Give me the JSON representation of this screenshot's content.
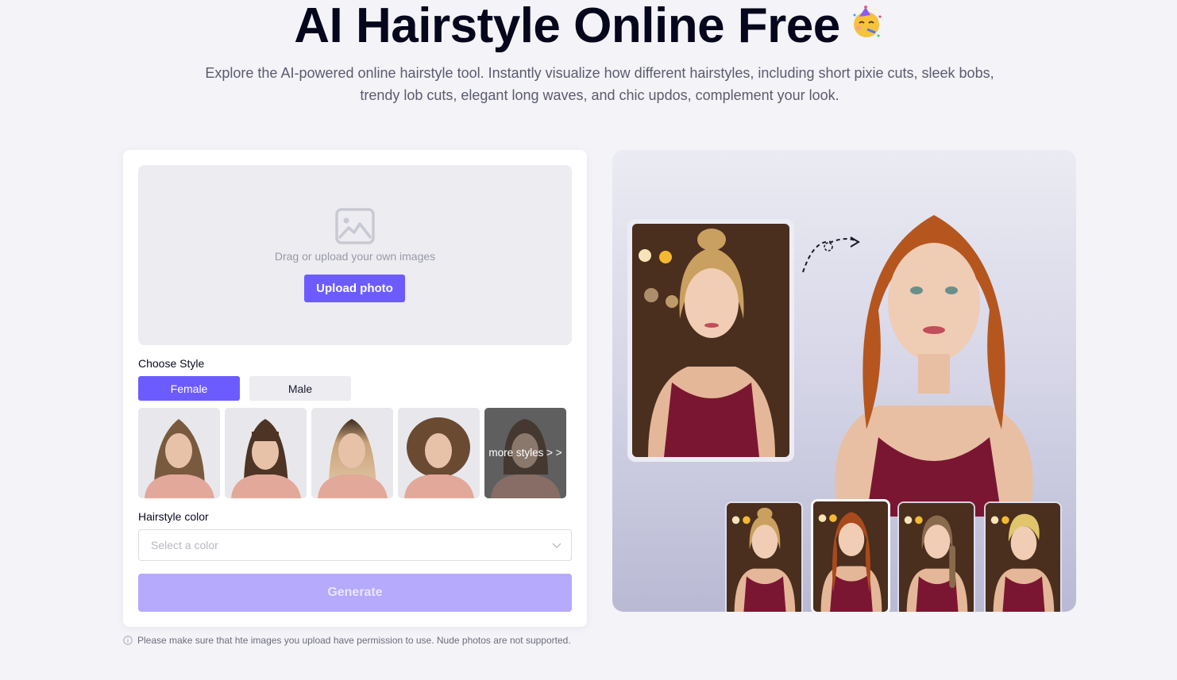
{
  "hero": {
    "title": "AI Hairstyle Online Free",
    "emoji_icon": "partying-face-icon",
    "subtitle": "Explore the AI-powered online hairstyle tool. Instantly visualize how different hairstyles, including short pixie cuts, sleek bobs, trendy lob cuts, elegant long waves, and chic updos, complement your look."
  },
  "uploader": {
    "icon": "image-placeholder-icon",
    "drop_text": "Drag or upload your own images",
    "upload_button": "Upload photo"
  },
  "style": {
    "label": "Choose Style",
    "genders": [
      {
        "label": "Female",
        "selected": true
      },
      {
        "label": "Male",
        "selected": false
      }
    ],
    "thumbnails": [
      {
        "name": "long-waves",
        "hair_color": "#7a5a3e"
      },
      {
        "name": "bangs-straight",
        "hair_color": "#4e3424"
      },
      {
        "name": "ombre-straight",
        "hair_color": "#c9a27a"
      },
      {
        "name": "retro-curls",
        "hair_color": "#6b4a32"
      }
    ],
    "more_styles": "more styles > >"
  },
  "hair_color": {
    "label": "Hairstyle color",
    "placeholder": "Select a color",
    "value": ""
  },
  "generate_button": "Generate",
  "notice": "Please make sure that hte images you upload have permission to use. Nude photos are not supported.",
  "showcase": {
    "original_hair": "#c9a060",
    "result_hair": "#b5561f",
    "dress_color": "#7a1632",
    "variants": [
      {
        "name": "updo-blonde",
        "hair": "#c9a060",
        "selected": false
      },
      {
        "name": "red-waves",
        "hair": "#a94a1c",
        "selected": true
      },
      {
        "name": "braids-brown",
        "hair": "#8a6a4c",
        "selected": false
      },
      {
        "name": "pixie-blonde",
        "hair": "#e0c56a",
        "selected": false
      }
    ]
  },
  "colors": {
    "accent": "#6c5cff",
    "accent_disabled": "#b5aafc",
    "page_bg": "#f3f3f8",
    "title": "#06061c"
  }
}
